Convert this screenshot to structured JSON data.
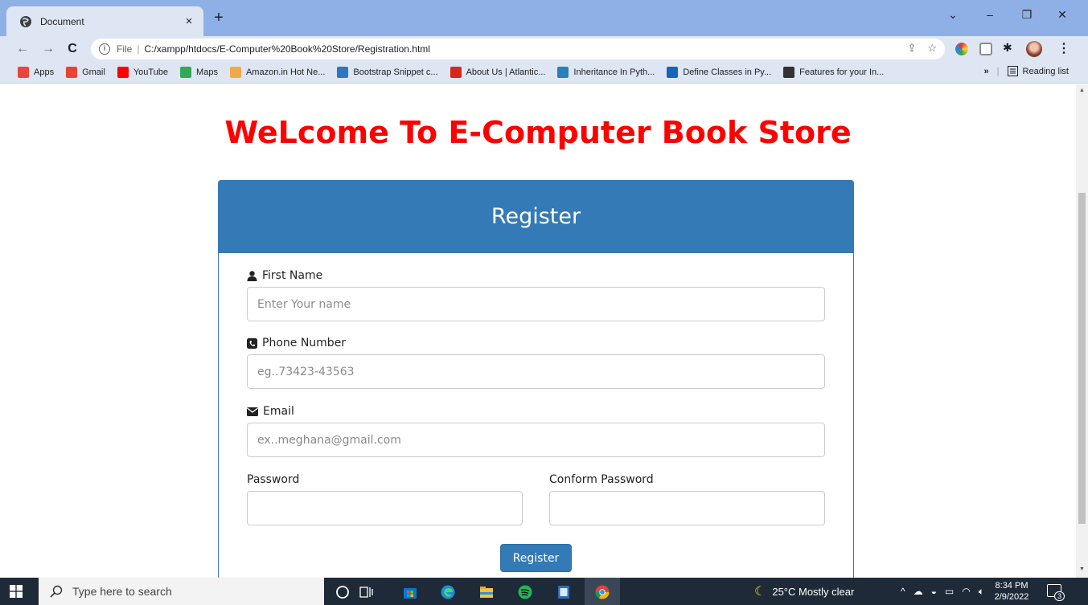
{
  "browser": {
    "tab_title": "Document",
    "tab_close": "×",
    "new_tab": "+",
    "url_scheme": "File",
    "url_separator": "|",
    "url_path": "C:/xampp/htdocs/E-Computer%20Book%20Store/Registration.html",
    "bookmarks": [
      {
        "label": "Apps",
        "icon": "apps-grid-icon",
        "color": "#e8453c"
      },
      {
        "label": "Gmail",
        "icon": "gmail-icon",
        "color": "#ea4335"
      },
      {
        "label": "YouTube",
        "icon": "youtube-icon",
        "color": "#ff0000"
      },
      {
        "label": "Maps",
        "icon": "maps-icon",
        "color": "#34a853"
      },
      {
        "label": "Amazon.in Hot Ne...",
        "icon": "amazon-icon",
        "color": "#f3a847"
      },
      {
        "label": "Bootstrap Snippet c...",
        "icon": "bootstrap-icon",
        "color": "#2a78c2"
      },
      {
        "label": "About Us | Atlantic...",
        "icon": "atlantic-icon",
        "color": "#d9261c"
      },
      {
        "label": "Inheritance In Pyth...",
        "icon": "e-icon",
        "color": "#2980b9"
      },
      {
        "label": "Define Classes in Py...",
        "icon": "t-icon",
        "color": "#1565c0"
      },
      {
        "label": "Features for your In...",
        "icon": "wordpress-icon",
        "color": "#333333"
      }
    ],
    "bookmarks_overflow": "»",
    "reading_list": "Reading list"
  },
  "page": {
    "welcome": "WeLcome To E-Computer Book Store",
    "panel_title": "Register",
    "fields": {
      "first_name": {
        "label": "First Name",
        "placeholder": "Enter Your name",
        "icon": "user-icon"
      },
      "phone": {
        "label": "Phone Number",
        "placeholder": "eg..73423-43563",
        "icon": "phone-square-icon"
      },
      "email": {
        "label": "Email",
        "placeholder": "ex..meghana@gmail.com",
        "icon": "envelope-icon"
      },
      "password": {
        "label": "Password",
        "placeholder": ""
      },
      "confirm_password": {
        "label": "Conform Password",
        "placeholder": ""
      }
    },
    "submit_label": "Register",
    "accent": "#337ab7",
    "title_color": "#ff0000"
  },
  "taskbar": {
    "search_placeholder": "Type here to search",
    "weather": "25°C  Mostly clear",
    "time": "8:34 PM",
    "date": "2/9/2022",
    "notification_count": "3"
  }
}
